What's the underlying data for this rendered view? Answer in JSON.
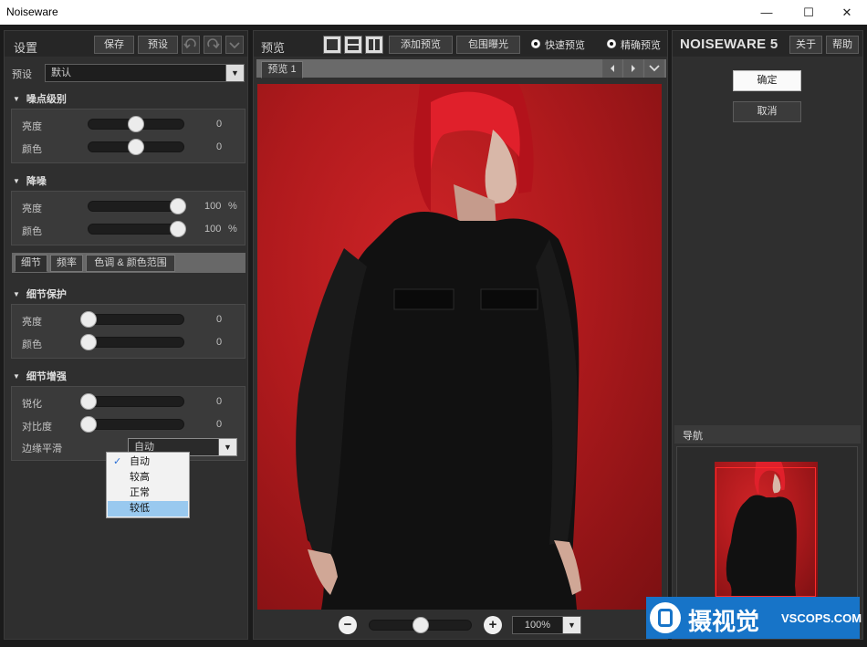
{
  "window": {
    "title": "Noiseware",
    "minimize": "—",
    "maximize": "☐",
    "close": "✕"
  },
  "settings": {
    "header": "设置",
    "save_button": "保存",
    "preset_button": "预设",
    "preset_label": "预设",
    "preset_value": "默认",
    "noise_level": {
      "title": "噪点级别",
      "rows": [
        {
          "label": "亮度",
          "value": "0",
          "level": 0.5
        },
        {
          "label": "颜色",
          "value": "0",
          "level": 0.5
        }
      ]
    },
    "noise_reduction": {
      "title": "降噪",
      "rows": [
        {
          "label": "亮度",
          "value": "100",
          "unit": "%",
          "level": 0.94
        },
        {
          "label": "颜色",
          "value": "100",
          "unit": "%",
          "level": 0.94
        }
      ]
    },
    "tabs": [
      "细节",
      "频率",
      "色调 & 颜色范围"
    ],
    "detail_protection": {
      "title": "细节保护",
      "rows": [
        {
          "label": "亮度",
          "value": "0",
          "level": 0.0
        },
        {
          "label": "颜色",
          "value": "0",
          "level": 0.0
        }
      ]
    },
    "detail_enhancement": {
      "title": "细节增强",
      "rows": [
        {
          "label": "锐化",
          "value": "0",
          "level": 0.0
        },
        {
          "label": "对比度",
          "value": "0",
          "level": 0.0
        }
      ],
      "edge_label": "边缘平滑",
      "edge_value": "自动",
      "options": [
        "自动",
        "较高",
        "正常",
        "较低"
      ]
    }
  },
  "preview": {
    "header": "预览",
    "add_preview": "添加预览",
    "clip_exposure": "包围曝光",
    "fast_preview": "快速预览",
    "accurate_preview": "精确预览",
    "tab": "预览 1",
    "zoom": "100%",
    "zoom_level": 0.5
  },
  "right": {
    "logo": "NOISEWARE 5",
    "about": "关于",
    "help": "帮助",
    "ok": "确定",
    "cancel": "取消",
    "navigator": "导航"
  },
  "watermark": {
    "cn": "摄视觉",
    "en": "VSCOPS.COM"
  }
}
